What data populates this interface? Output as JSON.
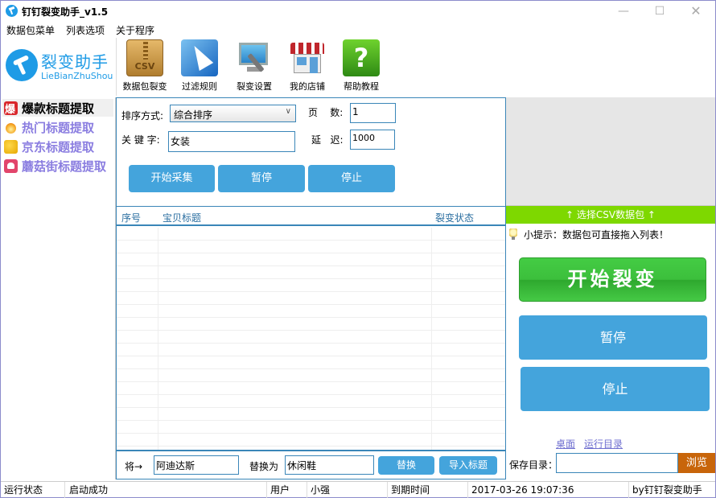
{
  "window": {
    "title": "钉钉裂变助手_v1.5",
    "controls": {
      "minimize": "—",
      "maximize": "☐",
      "close": "✕"
    }
  },
  "menu": [
    "数据包菜单",
    "列表选项",
    "关于程序"
  ],
  "logo": {
    "cn": "裂变助手",
    "en": "LieBianZhuShou"
  },
  "toolbar": [
    {
      "label": "数据包裂变",
      "icon": "csv-zip-icon",
      "icon_text": "CSV"
    },
    {
      "label": "过滤规则",
      "icon": "cursor-arrow-icon"
    },
    {
      "label": "裂变设置",
      "icon": "monitor-wrench-icon"
    },
    {
      "label": "我的店铺",
      "icon": "shop-icon"
    },
    {
      "label": "帮助教程",
      "icon": "help-icon",
      "icon_text": "?"
    }
  ],
  "sidebar": [
    {
      "label": "爆款标题提取",
      "icon": "bao-icon",
      "active": true
    },
    {
      "label": "热门标题提取",
      "icon": "fire-icon",
      "active": false
    },
    {
      "label": "京东标题提取",
      "icon": "jd-icon",
      "active": false
    },
    {
      "label": "蘑菇街标题提取",
      "icon": "mogujie-icon",
      "active": false
    }
  ],
  "form": {
    "sort_label": "排序方式:",
    "sort_value": "综合排序",
    "pages_label": "页    数:",
    "pages_value": "1",
    "keyword_label": "关 键 字:",
    "keyword_value": "女装",
    "delay_label": "延   迟:",
    "delay_value": "1000"
  },
  "actions": {
    "start": "开始采集",
    "pause": "暂停",
    "stop": "停止"
  },
  "list": {
    "columns": [
      "序号",
      "宝贝标题",
      "裂变状态"
    ],
    "rows": []
  },
  "replace": {
    "from_label": "将→",
    "from_value": "阿迪达斯",
    "to_label": "替换为",
    "to_value": "休闲鞋",
    "replace_button": "替换",
    "import_button": "导入标题"
  },
  "right": {
    "csv_bar": "↑ 选择CSV数据包 ↑",
    "tip": "小提示：数据包可直接拖入列表！",
    "start_button": "开始裂变",
    "pause_button": "暂停",
    "stop_button": "停止",
    "link_desktop": "桌面",
    "link_rundir": "运行目录",
    "save_label": "保存目录：",
    "save_value": "",
    "browse_button": "浏览"
  },
  "colors": {
    "accent_blue": "#44a4dc",
    "green": "#7ed800",
    "browse": "#c8650a"
  },
  "status": {
    "state_label": "运行状态",
    "state_value": "启动成功",
    "user_label": "用户",
    "user_value": "小强",
    "expire_label": "到期时间",
    "expire_value": "2017-03-26 19:07:36",
    "credit": "by钉钉裂变助手"
  }
}
